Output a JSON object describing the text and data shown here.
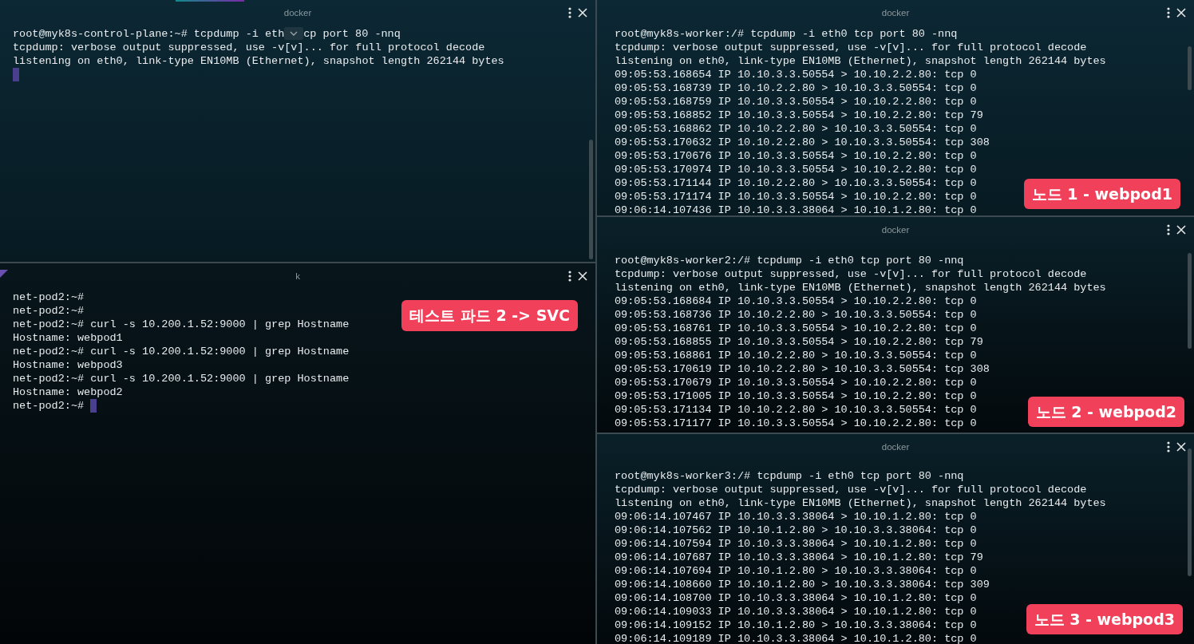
{
  "left_panes": [
    {
      "title": "docker",
      "lines": [
        {
          "kind": "covered",
          "before": "root@myk8s-control-plane:~# tcpdump -i eth",
          "after": "cp port 80 -nnq"
        },
        {
          "kind": "text",
          "text": "tcpdump: verbose output suppressed, use -v[v]... for full protocol decode"
        },
        {
          "kind": "text",
          "text": "listening on eth0, link-type EN10MB (Ethernet), snapshot length 262144 bytes"
        },
        {
          "kind": "cursor"
        }
      ]
    },
    {
      "title": "k",
      "badge": "테스트 파드 2 -> SVC",
      "lines": [
        {
          "kind": "text",
          "text": "net-pod2:~#"
        },
        {
          "kind": "text",
          "text": "net-pod2:~#"
        },
        {
          "kind": "text",
          "text": "net-pod2:~# curl -s 10.200.1.52:9000 | grep Hostname"
        },
        {
          "kind": "text",
          "text": "Hostname: webpod1"
        },
        {
          "kind": "text",
          "text": "net-pod2:~# curl -s 10.200.1.52:9000 | grep Hostname"
        },
        {
          "kind": "text",
          "text": "Hostname: webpod3"
        },
        {
          "kind": "text",
          "text": "net-pod2:~# curl -s 10.200.1.52:9000 | grep Hostname"
        },
        {
          "kind": "text",
          "text": "Hostname: webpod2"
        },
        {
          "kind": "prompt",
          "text": "net-pod2:~#"
        }
      ]
    }
  ],
  "right_panes": [
    {
      "title": "docker",
      "badge": "노드 1 - webpod1",
      "lines": [
        {
          "kind": "text",
          "text": "root@myk8s-worker:/# tcpdump -i eth0 tcp port 80 -nnq"
        },
        {
          "kind": "text",
          "text": "tcpdump: verbose output suppressed, use -v[v]... for full protocol decode"
        },
        {
          "kind": "text",
          "text": "listening on eth0, link-type EN10MB (Ethernet), snapshot length 262144 bytes"
        },
        {
          "kind": "text",
          "text": "09:05:53.168654 IP 10.10.3.3.50554 > 10.10.2.2.80: tcp 0"
        },
        {
          "kind": "text",
          "text": "09:05:53.168739 IP 10.10.2.2.80 > 10.10.3.3.50554: tcp 0"
        },
        {
          "kind": "text",
          "text": "09:05:53.168759 IP 10.10.3.3.50554 > 10.10.2.2.80: tcp 0"
        },
        {
          "kind": "text",
          "text": "09:05:53.168852 IP 10.10.3.3.50554 > 10.10.2.2.80: tcp 79"
        },
        {
          "kind": "text",
          "text": "09:05:53.168862 IP 10.10.2.2.80 > 10.10.3.3.50554: tcp 0"
        },
        {
          "kind": "text",
          "text": "09:05:53.170632 IP 10.10.2.2.80 > 10.10.3.3.50554: tcp 308"
        },
        {
          "kind": "text",
          "text": "09:05:53.170676 IP 10.10.3.3.50554 > 10.10.2.2.80: tcp 0"
        },
        {
          "kind": "text",
          "text": "09:05:53.170974 IP 10.10.3.3.50554 > 10.10.2.2.80: tcp 0"
        },
        {
          "kind": "text",
          "text": "09:05:53.171144 IP 10.10.2.2.80 > 10.10.3.3.50554: tcp 0"
        },
        {
          "kind": "text",
          "text": "09:05:53.171174 IP 10.10.3.3.50554 > 10.10.2.2.80: tcp 0"
        },
        {
          "kind": "text",
          "text": "09:06:14.107436 IP 10.10.3.3.38064 > 10.10.1.2.80: tcp 0"
        }
      ]
    },
    {
      "title": "docker",
      "badge": "노드 2 - webpod2",
      "lines": [
        {
          "kind": "text",
          "text": "root@myk8s-worker2:/# tcpdump -i eth0 tcp port 80 -nnq"
        },
        {
          "kind": "text",
          "text": "tcpdump: verbose output suppressed, use -v[v]... for full protocol decode"
        },
        {
          "kind": "text",
          "text": "listening on eth0, link-type EN10MB (Ethernet), snapshot length 262144 bytes"
        },
        {
          "kind": "text",
          "text": "09:05:53.168684 IP 10.10.3.3.50554 > 10.10.2.2.80: tcp 0"
        },
        {
          "kind": "text",
          "text": "09:05:53.168736 IP 10.10.2.2.80 > 10.10.3.3.50554: tcp 0"
        },
        {
          "kind": "text",
          "text": "09:05:53.168761 IP 10.10.3.3.50554 > 10.10.2.2.80: tcp 0"
        },
        {
          "kind": "text",
          "text": "09:05:53.168855 IP 10.10.3.3.50554 > 10.10.2.2.80: tcp 79"
        },
        {
          "kind": "text",
          "text": "09:05:53.168861 IP 10.10.2.2.80 > 10.10.3.3.50554: tcp 0"
        },
        {
          "kind": "text",
          "text": "09:05:53.170619 IP 10.10.2.2.80 > 10.10.3.3.50554: tcp 308"
        },
        {
          "kind": "text",
          "text": "09:05:53.170679 IP 10.10.3.3.50554 > 10.10.2.2.80: tcp 0"
        },
        {
          "kind": "text",
          "text": "09:05:53.171005 IP 10.10.3.3.50554 > 10.10.2.2.80: tcp 0"
        },
        {
          "kind": "text",
          "text": "09:05:53.171134 IP 10.10.2.2.80 > 10.10.3.3.50554: tcp 0"
        },
        {
          "kind": "text",
          "text": "09:05:53.171177 IP 10.10.3.3.50554 > 10.10.2.2.80: tcp 0"
        }
      ]
    },
    {
      "title": "docker",
      "badge": "노드 3 - webpod3",
      "lines": [
        {
          "kind": "text",
          "text": "root@myk8s-worker3:/# tcpdump -i eth0 tcp port 80 -nnq"
        },
        {
          "kind": "text",
          "text": "tcpdump: verbose output suppressed, use -v[v]... for full protocol decode"
        },
        {
          "kind": "text",
          "text": "listening on eth0, link-type EN10MB (Ethernet), snapshot length 262144 bytes"
        },
        {
          "kind": "text",
          "text": "09:06:14.107467 IP 10.10.3.3.38064 > 10.10.1.2.80: tcp 0"
        },
        {
          "kind": "text",
          "text": "09:06:14.107562 IP 10.10.1.2.80 > 10.10.3.3.38064: tcp 0"
        },
        {
          "kind": "text",
          "text": "09:06:14.107594 IP 10.10.3.3.38064 > 10.10.1.2.80: tcp 0"
        },
        {
          "kind": "text",
          "text": "09:06:14.107687 IP 10.10.3.3.38064 > 10.10.1.2.80: tcp 79"
        },
        {
          "kind": "text",
          "text": "09:06:14.107694 IP 10.10.1.2.80 > 10.10.3.3.38064: tcp 0"
        },
        {
          "kind": "text",
          "text": "09:06:14.108660 IP 10.10.1.2.80 > 10.10.3.3.38064: tcp 309"
        },
        {
          "kind": "text",
          "text": "09:06:14.108700 IP 10.10.3.3.38064 > 10.10.1.2.80: tcp 0"
        },
        {
          "kind": "text",
          "text": "09:06:14.109033 IP 10.10.3.3.38064 > 10.10.1.2.80: tcp 0"
        },
        {
          "kind": "text",
          "text": "09:06:14.109152 IP 10.10.1.2.80 > 10.10.3.3.38064: tcp 0"
        },
        {
          "kind": "text",
          "text": "09:06:14.109189 IP 10.10.3.3.38064 > 10.10.1.2.80: tcp 0"
        }
      ]
    }
  ]
}
